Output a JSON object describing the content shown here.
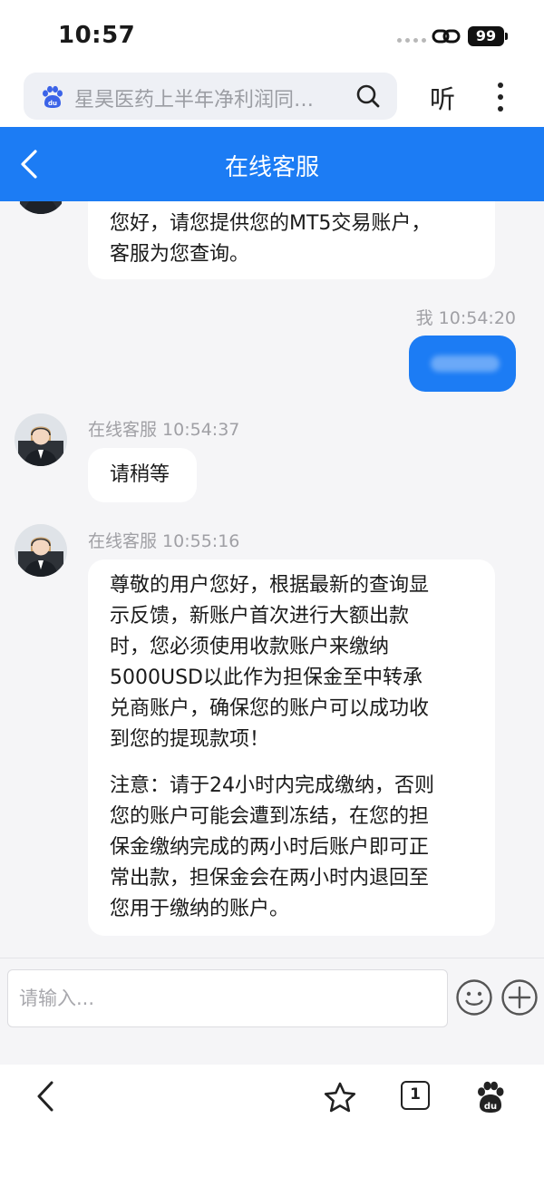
{
  "status_bar": {
    "time": "10:57",
    "battery": "99"
  },
  "browser": {
    "search_text": "星昊医药上半年净利润同…",
    "listen_label": "听"
  },
  "header": {
    "title": "在线客服"
  },
  "messages": [
    {
      "sender": "agent",
      "text_lines": [
        "您好，请您提供您的MT5交易账户，",
        "客服为您查询。"
      ]
    },
    {
      "sender": "me",
      "meta": "我 10:54:20"
    },
    {
      "sender": "agent",
      "meta": "在线客服 10:54:37",
      "text_lines": [
        "请稍等"
      ]
    },
    {
      "sender": "agent",
      "meta": "在线客服 10:55:16",
      "text_lines": [
        "尊敬的用户您好，根据最新的查询显",
        "示反馈，新账户首次进行大额出款",
        "时，您必须使用收款账户来缴纳",
        "5000USD以此作为担保金至中转承",
        "兑商账户，确保您的账户可以成功收",
        "到您的提现款项！",
        "",
        "注意：请于24小时内完成缴纳，否则",
        "您的账户可能会遭到冻结，在您的担",
        "保金缴纳完成的两小时后账户即可正",
        "常出款，担保金会在两小时内退回至",
        "您用于缴纳的账户。"
      ]
    }
  ],
  "input": {
    "placeholder": "请输入..."
  },
  "bottom_bar": {
    "tab_count": "1"
  },
  "icons": {
    "status": [
      "link-icon"
    ],
    "browser": [
      "baidu-paw-icon",
      "search-icon",
      "more-vertical-icon"
    ],
    "header": [
      "back-arrow-icon"
    ],
    "input": [
      "emoji-icon",
      "plus-circle-icon"
    ],
    "bottom": [
      "back-icon",
      "star-icon",
      "tabs-icon",
      "baidu-paw-icon"
    ]
  },
  "colors": {
    "accent_blue": "#1c7cf4",
    "chat_background": "#f5f5f7",
    "bubble_left": "#ffffff",
    "meta_text": "#a0a0a5"
  }
}
